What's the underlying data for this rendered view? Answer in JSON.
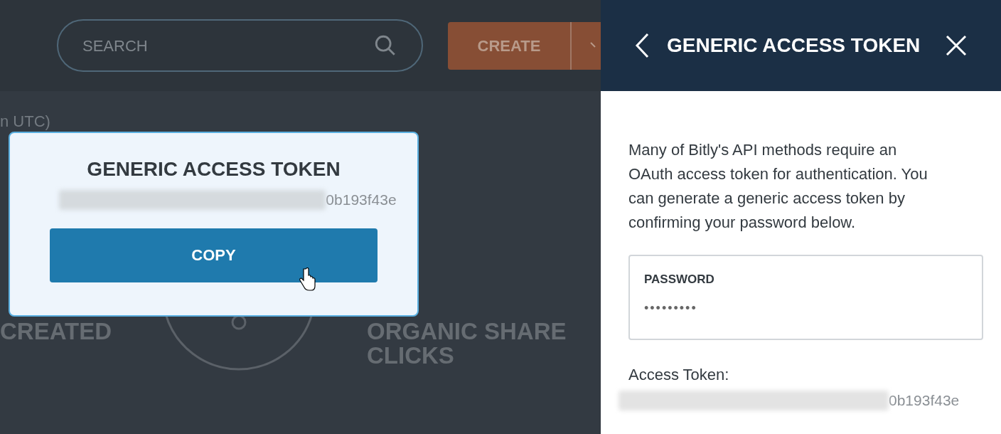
{
  "header": {
    "search": {
      "placeholder": "SEARCH"
    },
    "create_button": "CREATE"
  },
  "dashboard": {
    "subtitle": "n UTC)",
    "stats": [
      {
        "label": "CREATED"
      },
      {
        "label": "ORGANIC SHARE CLICKS"
      }
    ]
  },
  "modal": {
    "title": "GENERIC ACCESS TOKEN",
    "token": "0b193f43e",
    "button": "COPY"
  },
  "panel": {
    "title": "GENERIC ACCESS TOKEN",
    "description": "Many of Bitly's API methods require an OAuth access token for authentication. You can generate a generic access token by confirming your password below.",
    "password": {
      "label": "PASSWORD",
      "value": "•••••••••"
    },
    "token_label": "Access Token:",
    "token": "0b193f43e"
  }
}
